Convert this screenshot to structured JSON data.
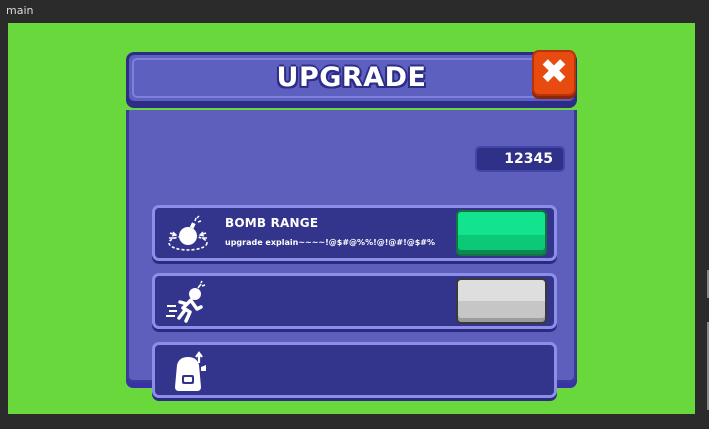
{
  "window": {
    "title": "main"
  },
  "dialog": {
    "title": "UPGRADE",
    "close_label": "✖",
    "coins": "12345",
    "rows": [
      {
        "icon": "bomb-icon",
        "name": "BOMB RANGE",
        "description": "upgrade explain~~~~!@$#@%%!@!@#!@$#%",
        "button_state": "green"
      },
      {
        "icon": "running-bomb-icon",
        "name": "",
        "description": "",
        "button_state": "gray"
      },
      {
        "icon": "backpack-icon",
        "name": "",
        "description": "",
        "button_state": ""
      }
    ]
  },
  "colors": {
    "background": "#69d83c",
    "panel": "#5e5fbd",
    "row": "#33358c",
    "close": "#e84b10",
    "green_button": "#11e38e",
    "gray_button": "#d4d4d4"
  }
}
